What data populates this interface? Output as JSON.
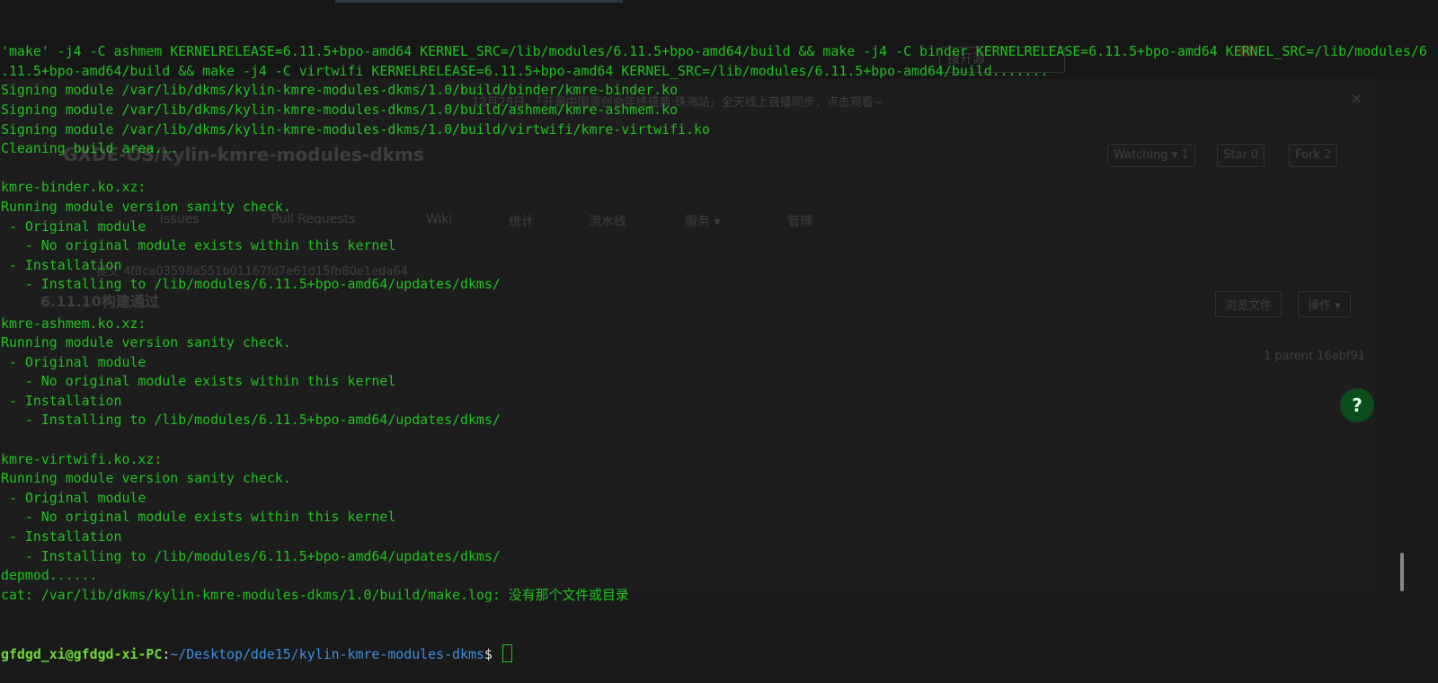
{
  "background_page": {
    "search_placeholder": "搜开源",
    "notification_count": "53",
    "banner": "12月28日，「开源中国源创会年终盛典·珠海站」全天线上直播同步，点击观看~",
    "close": "✕",
    "repo_title": "GXDE-OS/kylin-kmre-modules-dkms",
    "watching": "Watching ▾ 1",
    "star": "Star 0",
    "fork": "Fork 2",
    "tabs": [
      "Issues",
      "Pull Requests",
      "Wiki",
      "统计",
      "流水线",
      "服务 ▾",
      "管理"
    ],
    "commit_hash": "提交  4f8ca03598a551b01167fd7e61d15fb80e1eda64",
    "commit_title": "6.11.10构建通过",
    "browse_files": "浏览文件",
    "operations": "操作 ▾",
    "parent": "1 parent 16abf91",
    "help": "?"
  },
  "terminal": {
    "lines": [
      "'make' -j4 -C ashmem KERNELRELEASE=6.11.5+bpo-amd64 KERNEL_SRC=/lib/modules/6.11.5+bpo-amd64/build && make -j4 -C binder KERNELRELEASE=6.11.5+bpo-amd64 KERNEL_SRC=/lib/modules/6",
      ".11.5+bpo-amd64/build && make -j4 -C virtwifi KERNELRELEASE=6.11.5+bpo-amd64 KERNEL_SRC=/lib/modules/6.11.5+bpo-amd64/build.......",
      "Signing module /var/lib/dkms/kylin-kmre-modules-dkms/1.0/build/binder/kmre-binder.ko",
      "Signing module /var/lib/dkms/kylin-kmre-modules-dkms/1.0/build/ashmem/kmre-ashmem.ko",
      "Signing module /var/lib/dkms/kylin-kmre-modules-dkms/1.0/build/virtwifi/kmre-virtwifi.ko",
      "Cleaning build area...",
      "",
      "kmre-binder.ko.xz:",
      "Running module version sanity check.",
      " - Original module",
      "   - No original module exists within this kernel",
      " - Installation",
      "   - Installing to /lib/modules/6.11.5+bpo-amd64/updates/dkms/",
      "",
      "kmre-ashmem.ko.xz:",
      "Running module version sanity check.",
      " - Original module",
      "   - No original module exists within this kernel",
      " - Installation",
      "   - Installing to /lib/modules/6.11.5+bpo-amd64/updates/dkms/",
      "",
      "kmre-virtwifi.ko.xz:",
      "Running module version sanity check.",
      " - Original module",
      "   - No original module exists within this kernel",
      " - Installation",
      "   - Installing to /lib/modules/6.11.5+bpo-amd64/updates/dkms/",
      "depmod......",
      "cat: /var/lib/dkms/kylin-kmre-modules-dkms/1.0/build/make.log: 没有那个文件或目录"
    ],
    "prompt": {
      "user_host": "gfdgd_xi@gfdgd-xi-PC",
      "separator": ":",
      "path": "~/Desktop/dde15/kylin-kmre-modules-dkms",
      "symbol": "$ "
    }
  }
}
